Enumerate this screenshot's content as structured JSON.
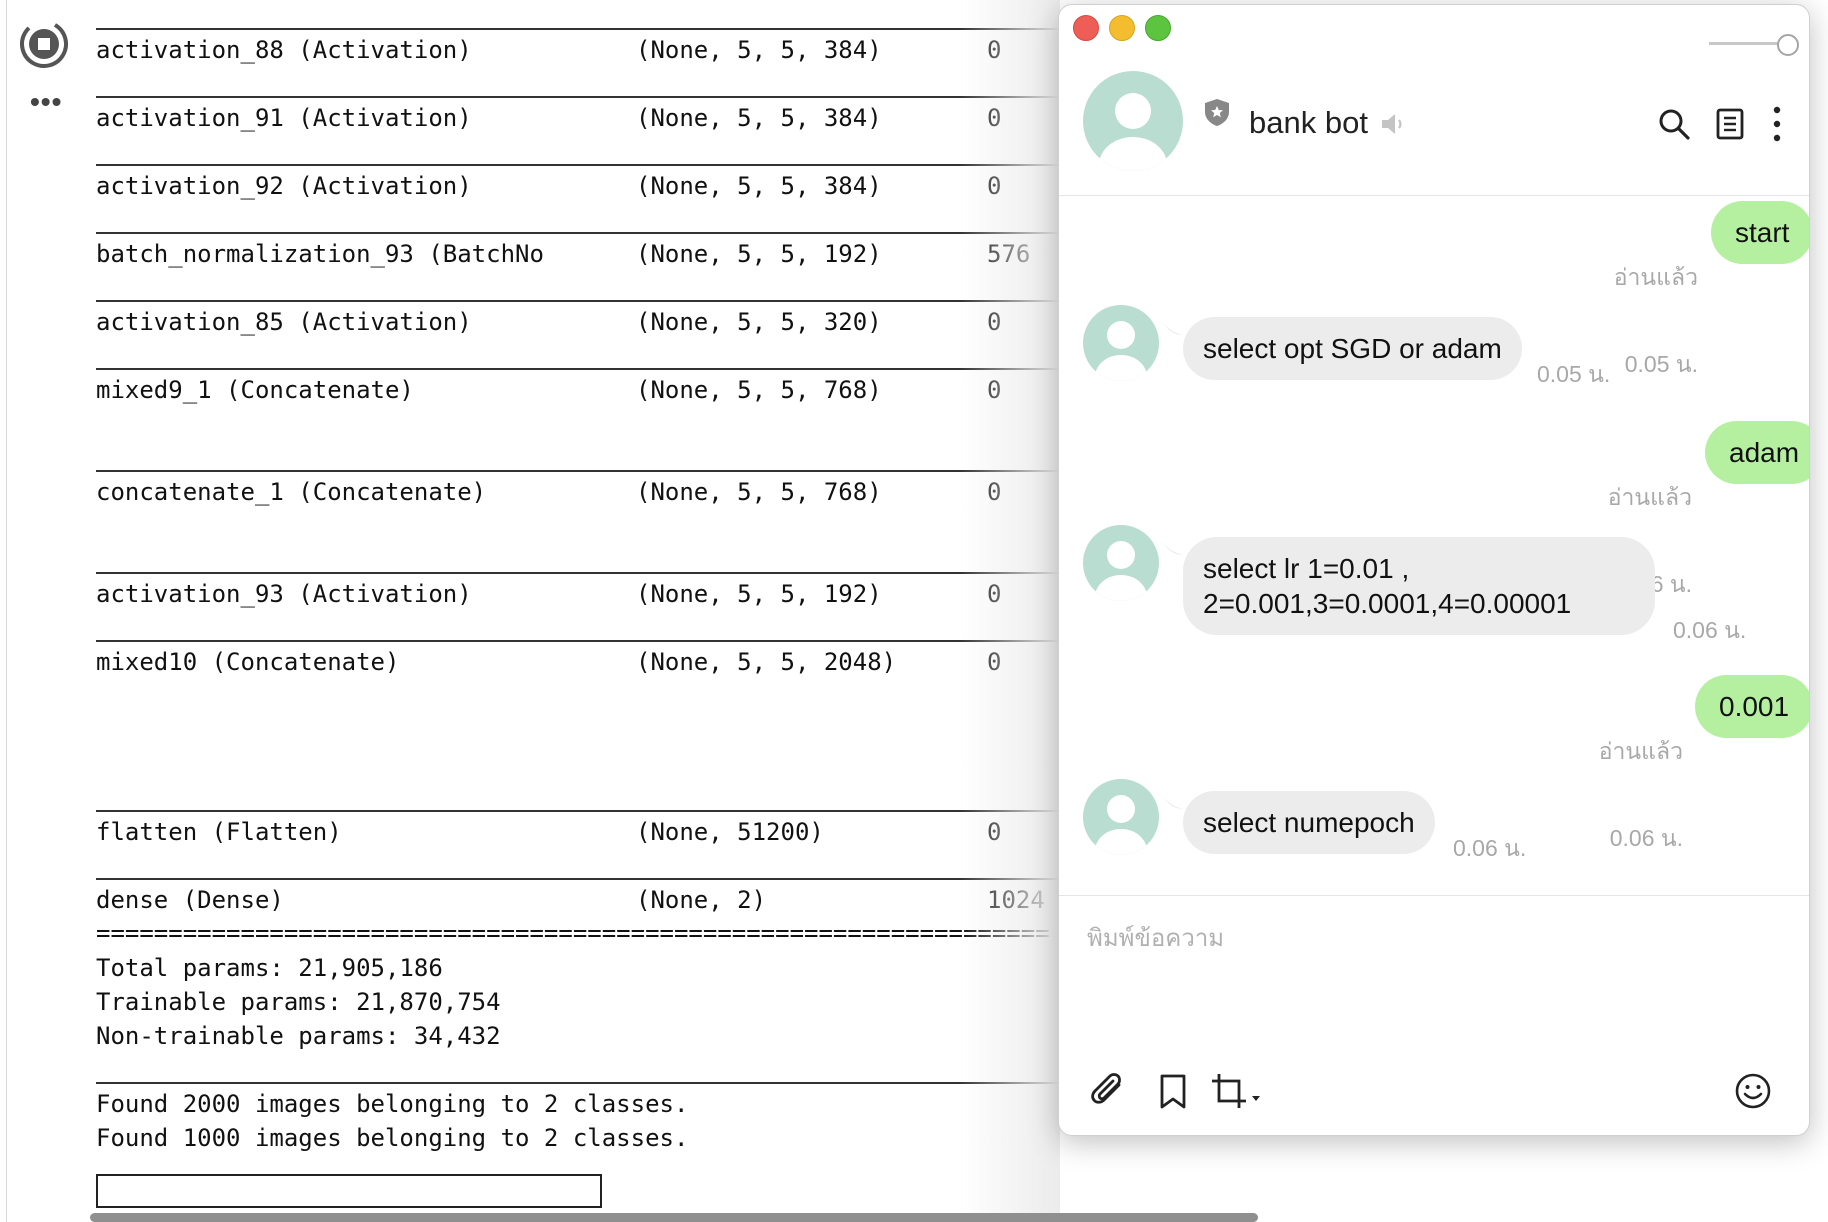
{
  "notebook": {
    "layers": [
      {
        "name": "activation_88 (Activation)",
        "shape": "(None, 5, 5, 384)",
        "params": "0"
      },
      {
        "name": "activation_91 (Activation)",
        "shape": "(None, 5, 5, 384)",
        "params": "0"
      },
      {
        "name": "activation_92 (Activation)",
        "shape": "(None, 5, 5, 384)",
        "params": "0"
      },
      {
        "name": "batch_normalization_93 (BatchNo",
        "shape": "(None, 5, 5, 192)",
        "params": "576"
      },
      {
        "name": "activation_85 (Activation)",
        "shape": "(None, 5, 5, 320)",
        "params": "0"
      },
      {
        "name": "mixed9_1 (Concatenate)",
        "shape": "(None, 5, 5, 768)",
        "params": "0"
      },
      {
        "name": "concatenate_1 (Concatenate)",
        "shape": "(None, 5, 5, 768)",
        "params": "0"
      },
      {
        "name": "activation_93 (Activation)",
        "shape": "(None, 5, 5, 192)",
        "params": "0"
      },
      {
        "name": "mixed10 (Concatenate)",
        "shape": "(None, 5, 5, 2048)",
        "params": "0"
      },
      {
        "name": "flatten (Flatten)",
        "shape": "(None, 51200)",
        "params": "0"
      },
      {
        "name": "dense (Dense)",
        "shape": "(None, 2)",
        "params": "1024"
      }
    ],
    "equals_line": "==================================================================",
    "total_params": "Total params: 21,905,186",
    "trainable_params": "Trainable params: 21,870,754",
    "non_trainable_params": "Non-trainable params: 34,432",
    "found_train": "Found 2000 images belonging to 2 classes.",
    "found_val": "Found 1000 images belonging to 2 classes."
  },
  "chat": {
    "title": "bank bot",
    "read_label": "อ่านแล้ว",
    "input_placeholder": "พิมพ์ข้อความ",
    "messages": [
      {
        "dir": "out",
        "text": "start",
        "time": "0.05 น."
      },
      {
        "dir": "in",
        "text": "select opt SGD or adam",
        "time": "0.05 น."
      },
      {
        "dir": "out",
        "text": "adam",
        "time": "0.06 น."
      },
      {
        "dir": "in",
        "text": "select lr 1=0.01 ,\n2=0.001,3=0.0001,4=0.00001",
        "time": "0.06 น."
      },
      {
        "dir": "out",
        "text": "0.001",
        "time": "0.06 น."
      },
      {
        "dir": "in",
        "text": "select numepoch",
        "time": "0.06 น."
      }
    ]
  },
  "colors": {
    "outgoing_bubble": "#b5f0a0",
    "incoming_bubble": "#ececec",
    "avatar": "#b9ddd0"
  },
  "icons": [
    "stop-icon",
    "ellipsis-icon",
    "shield-icon",
    "speaker-icon",
    "search-icon",
    "notes-icon",
    "more-vertical-icon",
    "paperclip-icon",
    "bookmark-icon",
    "crop-icon",
    "emoji-icon"
  ]
}
